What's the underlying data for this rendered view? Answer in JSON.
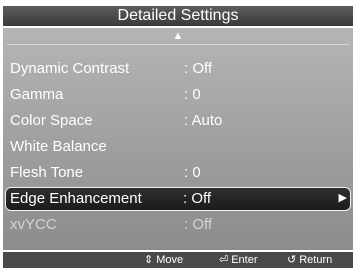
{
  "title": "Detailed Settings",
  "scroll_up_icon": "triangle-up",
  "rows": [
    {
      "label": "Dynamic Contrast",
      "value": ": Off"
    },
    {
      "label": "Gamma",
      "value": ": 0"
    },
    {
      "label": "Color Space",
      "value": ": Auto"
    },
    {
      "label": "White Balance",
      "value": ""
    },
    {
      "label": "Flesh Tone",
      "value": ": 0"
    },
    {
      "label": "Edge Enhancement",
      "value": ": Off"
    },
    {
      "label": "xvYCC",
      "value": ": Off"
    }
  ],
  "selected_row": "Edge Enhancement",
  "disabled_row": "xvYCC",
  "hints": {
    "move": "Move",
    "enter": "Enter",
    "return": "Return"
  },
  "colors": {
    "panel": "#a3a3a3",
    "title_bar": "#4a4a4a",
    "selected_bg": "#222222",
    "text": "#ffffff"
  }
}
